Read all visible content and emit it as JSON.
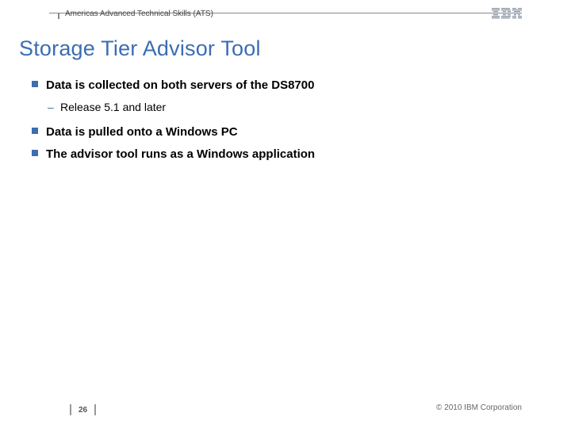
{
  "header": {
    "org": "Americas Advanced Technical Skills (ATS)",
    "logo_alt": "IBM"
  },
  "title": "Storage Tier Advisor Tool",
  "bullets": [
    {
      "level": 1,
      "text": "Data is collected on both servers of the DS8700",
      "children": [
        {
          "level": 2,
          "text": "Release 5.1 and later"
        }
      ]
    },
    {
      "level": 1,
      "text": "Data is pulled onto a Windows PC",
      "children": []
    },
    {
      "level": 1,
      "text": "The advisor tool runs as a Windows application",
      "children": []
    }
  ],
  "footer": {
    "page": "26",
    "copyright": "© 2010 IBM Corporation"
  }
}
